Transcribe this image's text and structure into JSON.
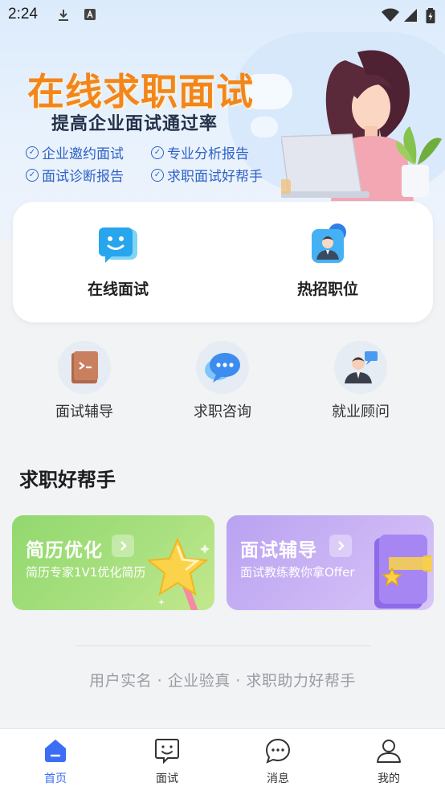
{
  "status_bar": {
    "time": "2:24"
  },
  "hero": {
    "title": "在线求职面试",
    "subtitle": "提高企业面试通过率",
    "features": [
      "企业邀约面试",
      "专业分析报告",
      "面试诊断报告",
      "求职面试好帮手"
    ]
  },
  "main_actions": [
    {
      "label": "在线面试",
      "icon": "smile-chat-icon"
    },
    {
      "label": "热招职位",
      "icon": "job-person-icon"
    }
  ],
  "quick_actions": [
    {
      "label": "面试辅导",
      "icon": "terminal-book-icon"
    },
    {
      "label": "求职咨询",
      "icon": "chat-bubble-icon"
    },
    {
      "label": "就业顾问",
      "icon": "advisor-icon"
    }
  ],
  "section": {
    "title": "求职好帮手"
  },
  "promos": [
    {
      "title": "简历优化",
      "subtitle": "简历专家1V1优化简历",
      "color": "#9edb75",
      "icon": "star-wand-icon"
    },
    {
      "title": "面试辅导",
      "subtitle": "面试教练教你拿Offer",
      "color": "#c3acf3",
      "icon": "book-icon"
    }
  ],
  "slogan": "用户实名 · 企业验真 · 求职助力好帮手",
  "tabbar": {
    "items": [
      {
        "label": "首页",
        "icon": "home-icon",
        "active": true
      },
      {
        "label": "面试",
        "icon": "interview-icon",
        "active": false
      },
      {
        "label": "消息",
        "icon": "message-icon",
        "active": false
      },
      {
        "label": "我的",
        "icon": "profile-icon",
        "active": false
      }
    ],
    "active_color": "#3b6ef5"
  }
}
